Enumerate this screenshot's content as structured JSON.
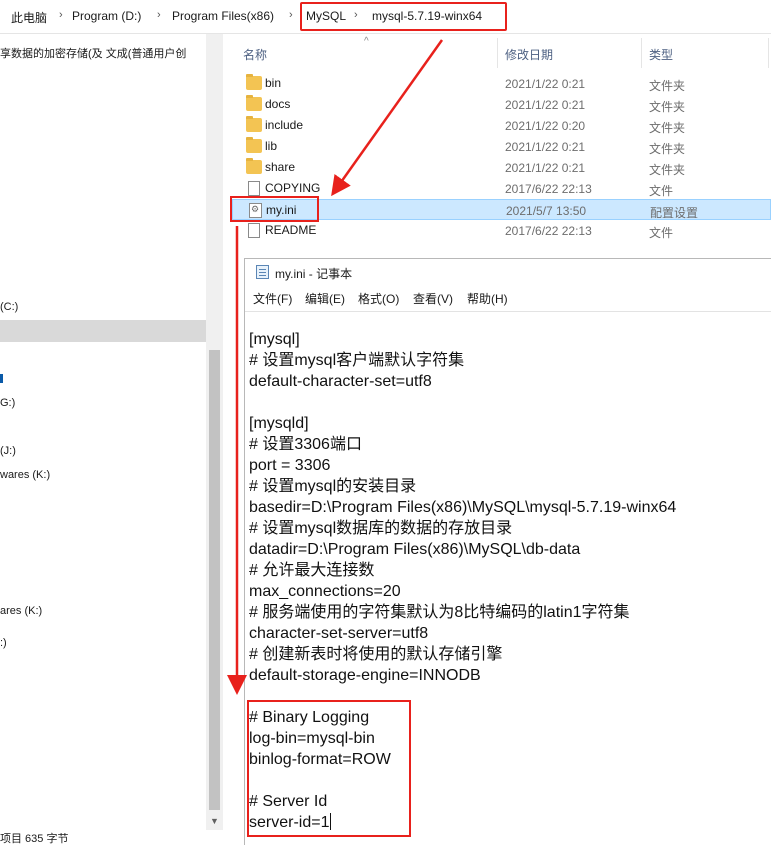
{
  "breadcrumb": {
    "items": [
      "此电脑",
      "Program (D:)",
      "Program Files(x86)",
      "MySQL",
      "mysql-5.7.19-winx64"
    ],
    "separator": "›"
  },
  "navpane": {
    "items": [
      "享数据的加密存储(及 文成(普通用户创",
      "(C:)",
      "",
      "G:)",
      "(J:)",
      "wares (K:)",
      "ares (K:)",
      ":)"
    ]
  },
  "columns": {
    "name": "名称",
    "date": "修改日期",
    "type": "类型"
  },
  "files": [
    {
      "name": "bin",
      "date": "2021/1/22 0:21",
      "type": "文件夹",
      "icon": "folder-icon"
    },
    {
      "name": "docs",
      "date": "2021/1/22 0:21",
      "type": "文件夹",
      "icon": "folder-icon"
    },
    {
      "name": "include",
      "date": "2021/1/22 0:20",
      "type": "文件夹",
      "icon": "folder-icon"
    },
    {
      "name": "lib",
      "date": "2021/1/22 0:21",
      "type": "文件夹",
      "icon": "folder-icon"
    },
    {
      "name": "share",
      "date": "2021/1/22 0:21",
      "type": "文件夹",
      "icon": "folder-icon"
    },
    {
      "name": "COPYING",
      "date": "2017/6/22 22:13",
      "type": "文件",
      "icon": "file-icon"
    },
    {
      "name": "my.ini",
      "date": "2021/5/7 13:50",
      "type": "配置设置",
      "icon": "ini-file-icon",
      "selected": true
    },
    {
      "name": "README",
      "date": "2017/6/22 22:13",
      "type": "文件",
      "icon": "file-icon"
    }
  ],
  "statusbar": {
    "text": "项目  635 字节"
  },
  "notepad": {
    "title": "my.ini - 记事本",
    "menu": [
      "文件(F)",
      "编辑(E)",
      "格式(O)",
      "查看(V)",
      "帮助(H)"
    ],
    "lines": [
      "[mysql]",
      "# 设置mysql客户端默认字符集",
      "default-character-set=utf8",
      "",
      "[mysqld]",
      "# 设置3306端口",
      "port = 3306",
      "# 设置mysql的安装目录",
      "basedir=D:\\Program Files(x86)\\MySQL\\mysql-5.7.19-winx64",
      "# 设置mysql数据库的数据的存放目录",
      "datadir=D:\\Program Files(x86)\\MySQL\\db-data",
      "# 允许最大连接数",
      "max_connections=20",
      "# 服务端使用的字符集默认为8比特编码的latin1字符集",
      "character-set-server=utf8",
      "# 创建新表时将使用的默认存储引擎",
      "default-storage-engine=INNODB",
      "",
      "# Binary Logging",
      "log-bin=mysql-bin",
      "binlog-format=ROW",
      "",
      "# Server Id",
      "server-id=1"
    ]
  },
  "colors": {
    "annotation": "#e8211c",
    "selection": "#cce8ff",
    "folder": "#f3c453"
  }
}
